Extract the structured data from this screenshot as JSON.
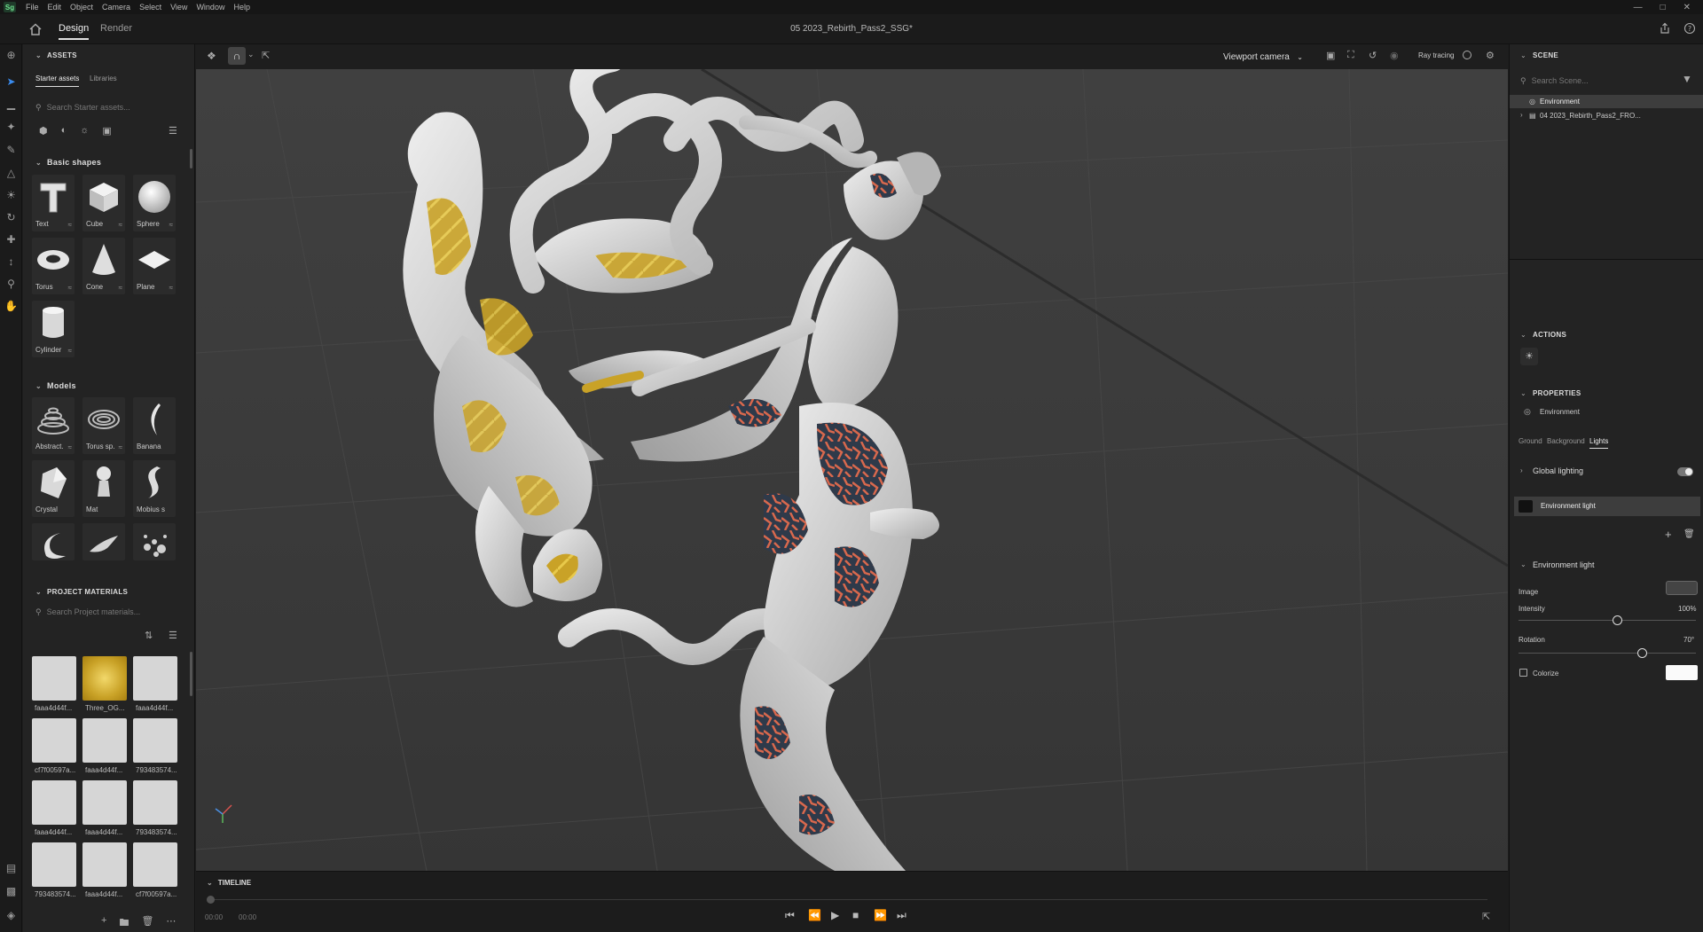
{
  "menubar": {
    "logo": "Sg",
    "items": [
      "File",
      "Edit",
      "Object",
      "Camera",
      "Select",
      "View",
      "Window",
      "Help"
    ]
  },
  "topbar": {
    "tabs": [
      "Design",
      "Render"
    ],
    "document_title": "05 2023_Rebirth_Pass2_SSG*"
  },
  "assets": {
    "title": "ASSETS",
    "subtabs": [
      "Starter assets",
      "Libraries"
    ],
    "search_placeholder": "Search Starter assets...",
    "basic_shapes_title": "Basic shapes",
    "basic_shapes": [
      "Text",
      "Cube",
      "Sphere",
      "Torus",
      "Cone",
      "Plane",
      "Cylinder"
    ],
    "models_title": "Models",
    "models": [
      "Abstract...",
      "Torus sp...",
      "Banana",
      "Crystal",
      "Mat",
      "Mobius strip"
    ]
  },
  "project_materials": {
    "title": "PROJECT MATERIALS",
    "search_placeholder": "Search Project materials...",
    "items": [
      "faaa4d44f...",
      "Three_OG...",
      "faaa4d44f...",
      "cf7f00597a...",
      "faaa4d44f...",
      "793483574...",
      "faaa4d44f...",
      "faaa4d44f...",
      "793483574...",
      "793483574...",
      "faaa4d44f...",
      "cf7f00597a..."
    ]
  },
  "viewport_bar": {
    "camera_select": "Viewport camera",
    "ray_tracing_label": "Ray tracing"
  },
  "timeline": {
    "title": "TIMELINE",
    "time_current": "00:00",
    "time_total": "00:00"
  },
  "scene": {
    "title": "SCENE",
    "search_placeholder": "Search Scene...",
    "items": [
      "Environment",
      "04 2023_Rebirth_Pass2_FRO..."
    ]
  },
  "actions": {
    "title": "ACTIONS"
  },
  "properties": {
    "title": "PROPERTIES",
    "object_name": "Environment",
    "tabs": [
      "Ground",
      "Background",
      "Lights"
    ],
    "active_tab": "Lights",
    "global_lighting_label": "Global lighting",
    "global_lighting_on": true,
    "env_light_item": "Environment light"
  },
  "environment_light": {
    "title": "Environment light",
    "image_label": "Image",
    "intensity_label": "Intensity",
    "intensity_value": "100%",
    "intensity_fraction": 0.56,
    "rotation_label": "Rotation",
    "rotation_value": "70°",
    "rotation_fraction": 0.7,
    "colorize_label": "Colorize",
    "colorize_checked": false
  },
  "colors": {
    "app_bg": "#1e1e1e",
    "panel_bg": "#232323",
    "viewport_bg": "#3d3d3d",
    "accent": "#3a8cf0",
    "gold_material": "#c9a227",
    "coral_material": "#d8684d"
  }
}
